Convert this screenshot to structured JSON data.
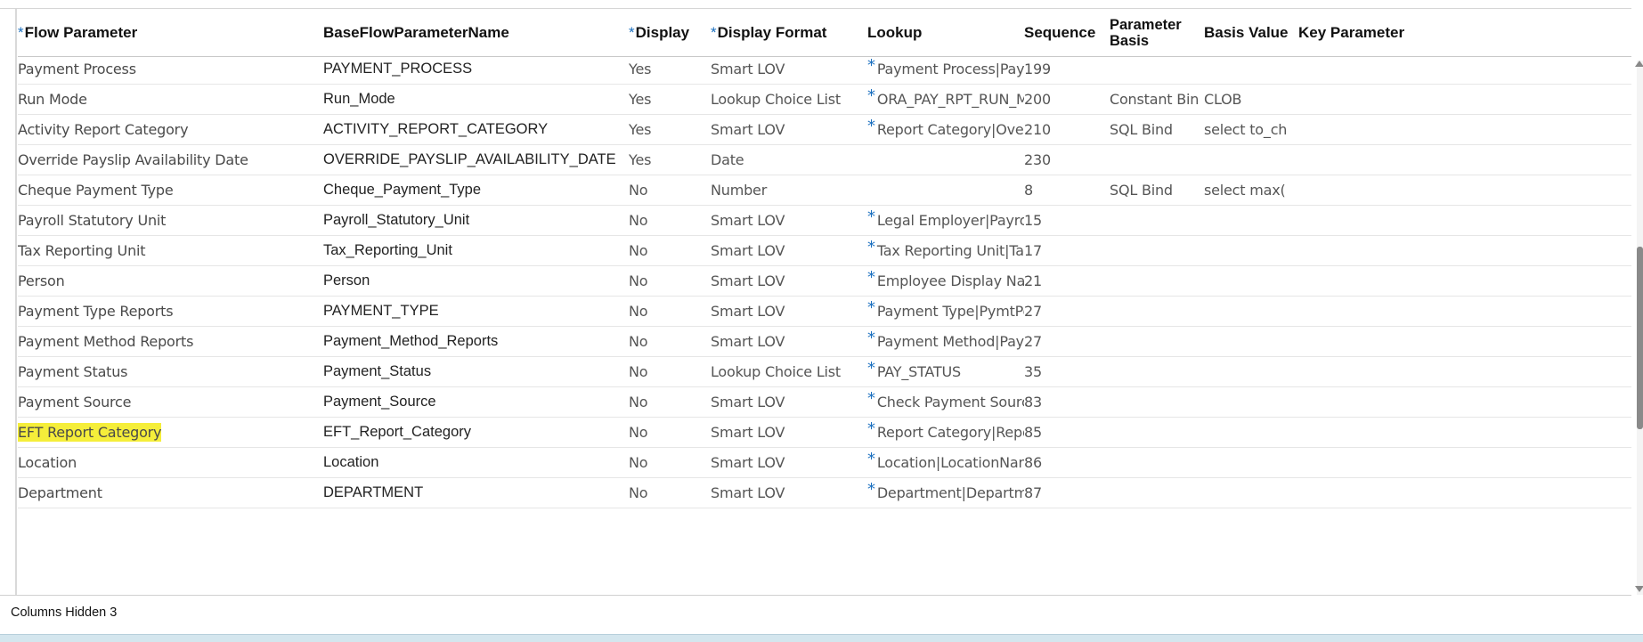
{
  "header": {
    "flow_parameter": "Flow Parameter",
    "base_name": "BaseFlowParameterName",
    "display": "Display",
    "display_format": "Display Format",
    "lookup": "Lookup",
    "sequence": "Sequence",
    "parameter_basis": "Parameter Basis",
    "basis_value": "Basis Value",
    "key_parameter": "Key Parameter",
    "required_mark": "*"
  },
  "rows": [
    {
      "flow": "Payment Process",
      "base": "PAYMENT_PROCESS",
      "display": "Yes",
      "format": "Smart LOV",
      "lookup_required": true,
      "lookup": "Payment Process|PaymentP",
      "seq": "199",
      "basis": "",
      "value": ""
    },
    {
      "flow": "Run Mode",
      "base": "Run_Mode",
      "display": "Yes",
      "format": "Lookup Choice List",
      "lookup_required": true,
      "lookup": "ORA_PAY_RPT_RUN_MODE",
      "seq": "200",
      "basis": "Constant Bind",
      "value": "CLOB"
    },
    {
      "flow": "Activity Report Category",
      "base": "ACTIVITY_REPORT_CATEGORY",
      "display": "Yes",
      "format": "Smart LOV",
      "lookup_required": true,
      "lookup": "Report Category|Overridin",
      "seq": "210",
      "basis": "SQL Bind",
      "value": "select to_cha..."
    },
    {
      "flow": "Override Payslip Availability Date",
      "base": "OVERRIDE_PAYSLIP_AVAILABILITY_DATE",
      "display": "Yes",
      "format": "Date",
      "lookup_required": false,
      "lookup": "",
      "seq": "230",
      "basis": "",
      "value": ""
    },
    {
      "flow": "Cheque Payment Type",
      "base": "Cheque_Payment_Type",
      "display": "No",
      "format": "Number",
      "lookup_required": false,
      "lookup": "",
      "seq": "8",
      "basis": "SQL Bind",
      "value": "select max(B..."
    },
    {
      "flow": "Payroll Statutory Unit",
      "base": "Payroll_Statutory_Unit",
      "display": "No",
      "format": "Smart LOV",
      "lookup_required": true,
      "lookup": "Legal Employer|PayrollStat",
      "seq": "15",
      "basis": "",
      "value": ""
    },
    {
      "flow": "Tax Reporting Unit",
      "base": "Tax_Reporting_Unit",
      "display": "No",
      "format": "Smart LOV",
      "lookup_required": true,
      "lookup": "Tax Reporting Unit|TaxRep",
      "seq": "17",
      "basis": "",
      "value": ""
    },
    {
      "flow": "Person",
      "base": "Person",
      "display": "No",
      "format": "Smart LOV",
      "lookup_required": true,
      "lookup": "Employee Display Name|Pe",
      "seq": "21",
      "basis": "",
      "value": ""
    },
    {
      "flow": "Payment Type Reports",
      "base": "PAYMENT_TYPE",
      "display": "No",
      "format": "Smart LOV",
      "lookup_required": true,
      "lookup": "Payment Type|PymtPerPay",
      "seq": "27",
      "basis": "",
      "value": ""
    },
    {
      "flow": "Payment Method Reports",
      "base": "Payment_Method_Reports",
      "display": "No",
      "format": "Smart LOV",
      "lookup_required": true,
      "lookup": "Payment Method|Payment",
      "seq": "27",
      "basis": "",
      "value": ""
    },
    {
      "flow": "Payment Status",
      "base": "Payment_Status",
      "display": "No",
      "format": "Lookup Choice List",
      "lookup_required": true,
      "lookup": "PAY_STATUS",
      "seq": "35",
      "basis": "",
      "value": ""
    },
    {
      "flow": "Payment Source",
      "base": "Payment_Source",
      "display": "No",
      "format": "Smart LOV",
      "lookup_required": true,
      "lookup": "Check Payment Source|Che",
      "seq": "83",
      "basis": "",
      "value": ""
    },
    {
      "flow": "EFT Report Category",
      "base": "EFT_Report_Category",
      "display": "No",
      "format": "Smart LOV",
      "lookup_required": true,
      "lookup": "Report Category|ReportCa",
      "seq": "85",
      "basis": "",
      "value": "",
      "highlighted": true
    },
    {
      "flow": "Location",
      "base": "Location",
      "display": "No",
      "format": "Smart LOV",
      "lookup_required": true,
      "lookup": "Location|LocationNamePV",
      "seq": "86",
      "basis": "",
      "value": ""
    },
    {
      "flow": "Department",
      "base": "DEPARTMENT",
      "display": "No",
      "format": "Smart LOV",
      "lookup_required": true,
      "lookup": "Department|DepartmentP",
      "seq": "87",
      "basis": "",
      "value": ""
    }
  ],
  "footer": {
    "columns_hidden_label": "Columns Hidden",
    "columns_hidden_count": "3"
  },
  "colors": {
    "required": "#1a6fbf",
    "highlight": "#f5ee3a"
  }
}
